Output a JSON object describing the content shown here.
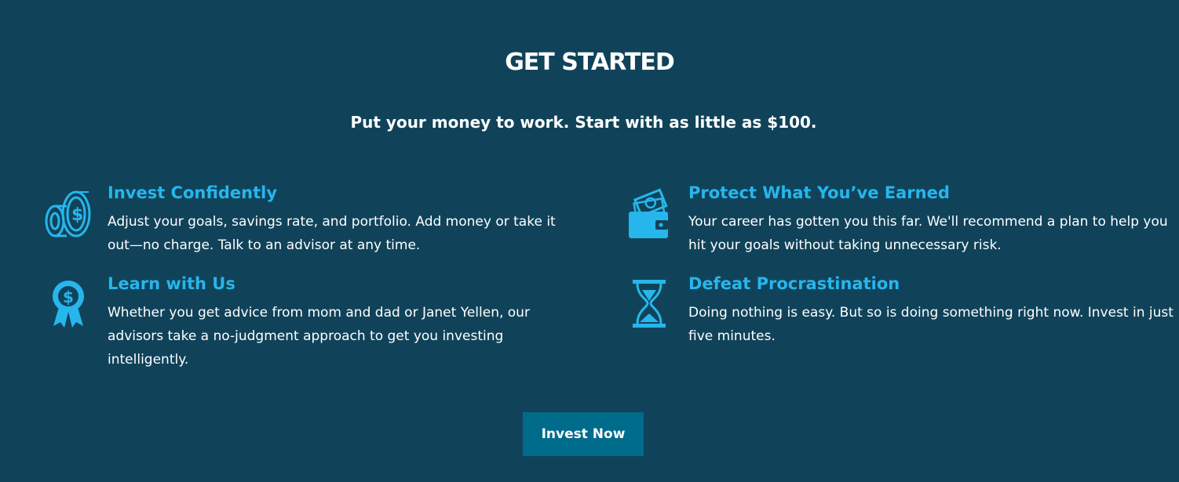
{
  "header": {
    "title": "GET STARTED",
    "subtitle": "Put your money to work. Start with as little as $100."
  },
  "features": [
    {
      "icon": "coins-icon",
      "title": "Invest Confidently",
      "description": "Adjust your goals, savings rate, and portfolio. Add money or take it out—no charge. Talk to an advisor at any time."
    },
    {
      "icon": "wallet-icon",
      "title": "Protect What You’ve Earned",
      "description": "Your career has gotten you this far. We'll recommend a plan to help you hit your goals without taking unnecessary risk."
    },
    {
      "icon": "award-ribbon-icon",
      "title": "Learn with Us",
      "description": "Whether you get advice from mom and dad or Janet Yellen, our advisors take a no-judgment approach to get you investing intelligently."
    },
    {
      "icon": "hourglass-icon",
      "title": "Defeat Procrastination",
      "description": "Doing nothing is easy. But so is doing something right now. Invest in just five minutes."
    }
  ],
  "cta": {
    "label": "Invest Now"
  },
  "colors": {
    "background": "#10435a",
    "accent": "#27b6ec",
    "button": "#006c8c",
    "text": "#ffffff"
  }
}
